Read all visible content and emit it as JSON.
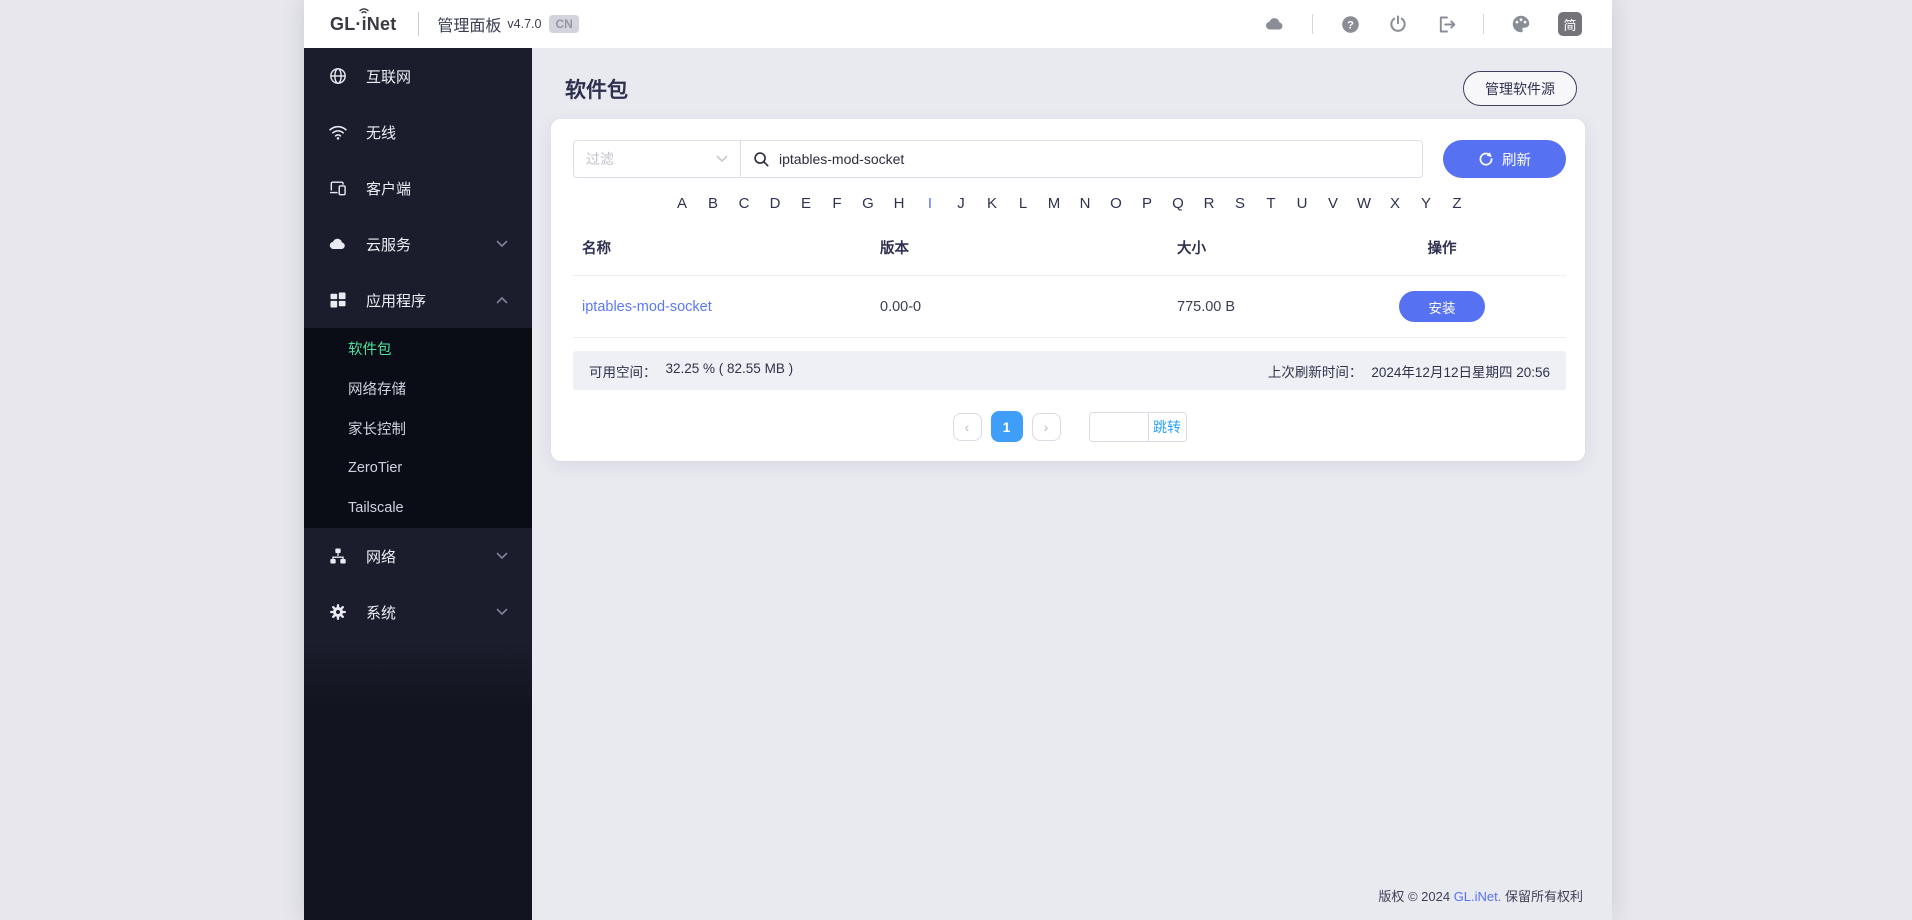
{
  "header": {
    "logo": {
      "part1": "GL·",
      "part2": "i",
      "part3": "Net"
    },
    "panel_title": "管理面板",
    "version": "v4.7.0",
    "cn_badge": "CN",
    "lang_badge": "简"
  },
  "sidebar": {
    "items": [
      {
        "label": "互联网",
        "icon": "globe-icon"
      },
      {
        "label": "无线",
        "icon": "wifi-icon"
      },
      {
        "label": "客户端",
        "icon": "devices-icon"
      },
      {
        "label": "云服务",
        "icon": "cloud-icon",
        "chevron": "down"
      },
      {
        "label": "应用程序",
        "icon": "apps-icon",
        "chevron": "up"
      }
    ],
    "submenu_items": [
      {
        "label": "软件包",
        "active": true
      },
      {
        "label": "网络存储",
        "active": false
      },
      {
        "label": "家长控制",
        "active": false
      },
      {
        "label": "ZeroTier",
        "active": false
      },
      {
        "label": "Tailscale",
        "active": false
      }
    ],
    "bottom_items": [
      {
        "label": "网络",
        "icon": "network-icon",
        "chevron": "down"
      },
      {
        "label": "系统",
        "icon": "gear-icon",
        "chevron": "down"
      }
    ]
  },
  "page": {
    "title": "软件包",
    "manage_sources_label": "管理软件源"
  },
  "toolbar": {
    "filter_placeholder": "过滤",
    "search_value": "iptables-mod-socket",
    "refresh_label": "刷新"
  },
  "alphabet": {
    "letters": [
      "A",
      "B",
      "C",
      "D",
      "E",
      "F",
      "G",
      "H",
      "I",
      "J",
      "K",
      "L",
      "M",
      "N",
      "O",
      "P",
      "Q",
      "R",
      "S",
      "T",
      "U",
      "V",
      "W",
      "X",
      "Y",
      "Z"
    ],
    "active_letter": "I"
  },
  "table": {
    "columns": [
      "名称",
      "版本",
      "大小",
      "操作"
    ],
    "rows": [
      {
        "name": "iptables-mod-socket",
        "version": "0.00-0",
        "size": "775.00 B",
        "action_label": "安装"
      }
    ]
  },
  "statusbar": {
    "space_label": "可用空间：",
    "space_value": "32.25 % ( 82.55 MB )",
    "refreshed_label": "上次刷新时间：",
    "refreshed_value": "2024年12月12日星期四 20:56"
  },
  "pagination": {
    "prev": "‹",
    "page": "1",
    "next": "›",
    "jump_value": "",
    "jump_label": "跳转"
  },
  "footer": {
    "prefix": "版权 © 2024 ",
    "brand": "GL.iNet.",
    "suffix": " 保留所有权利"
  },
  "colors": {
    "accent": "#5671f1",
    "sidebar_active": "#4fe3a1",
    "pagination_active": "#3f9ef8",
    "jump_link": "#2aa3f8",
    "table_link": "#5b79f4"
  }
}
